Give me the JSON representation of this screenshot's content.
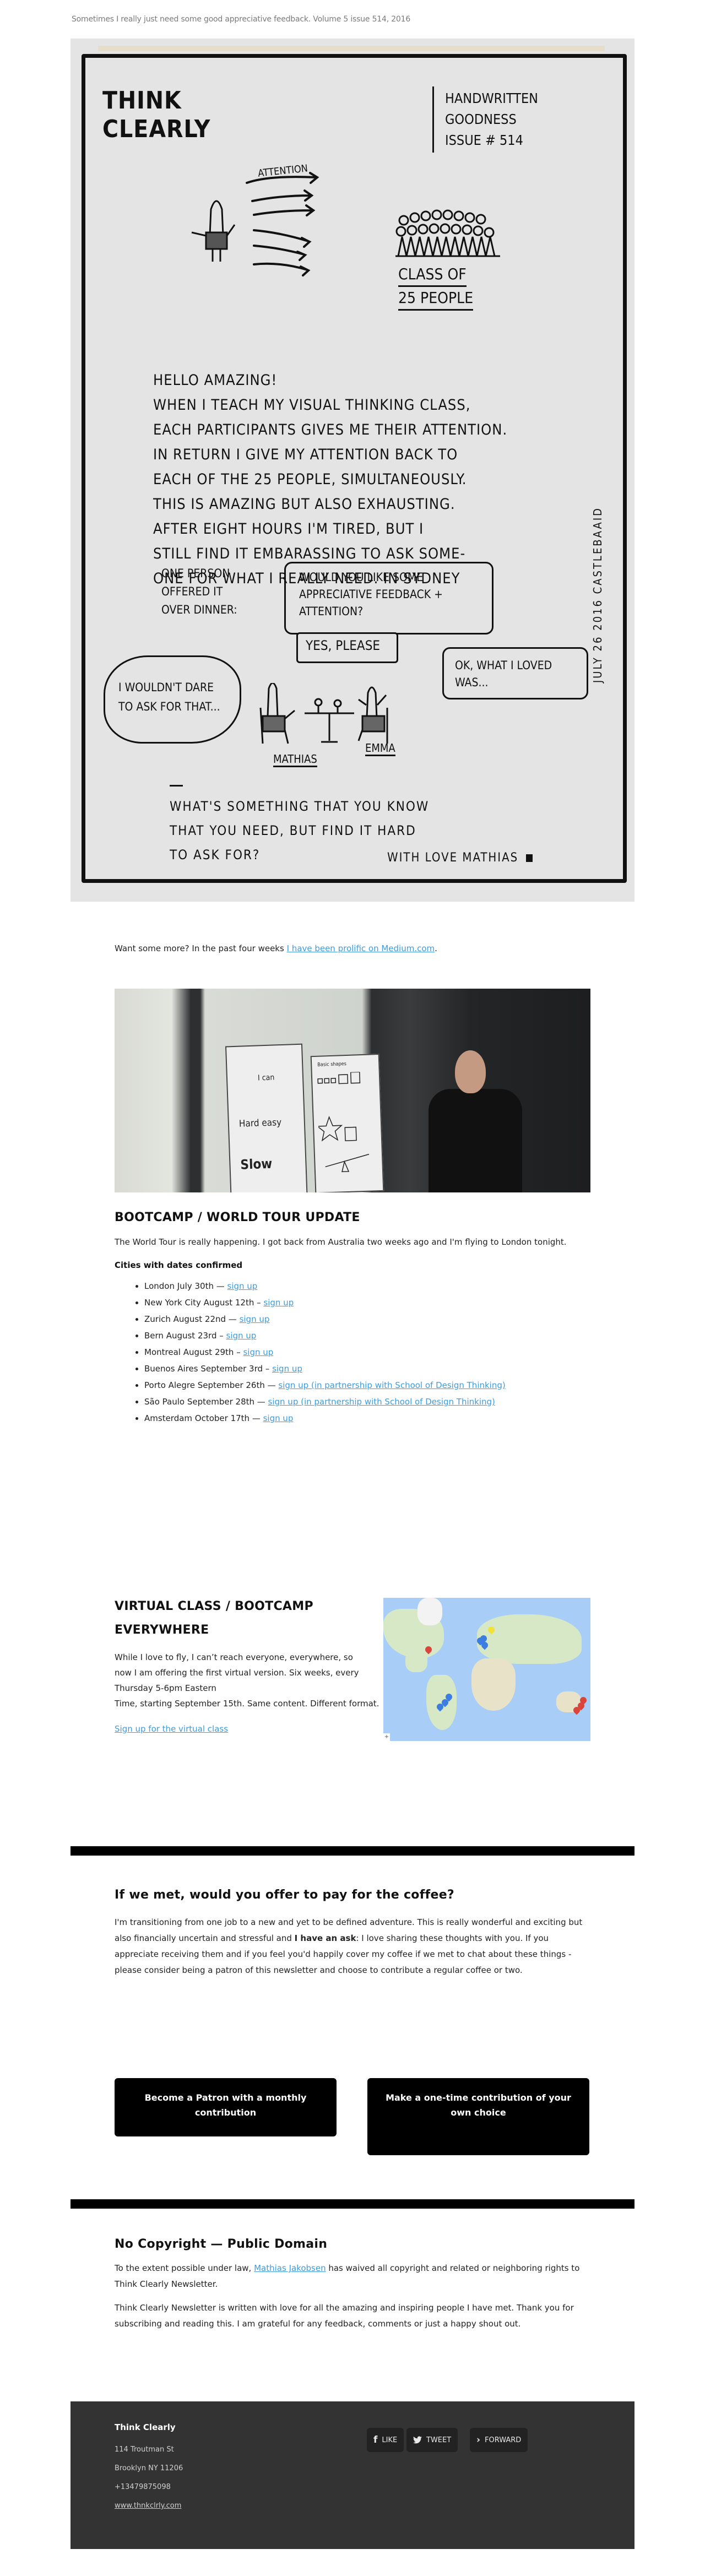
{
  "preheader": "Sometimes I really just need some good appreciative feedback. Volume 5 issue 514, 2016",
  "sketch": {
    "title_lines": [
      "Think",
      "Clearly"
    ],
    "meta_lines": [
      "Handwritten",
      "Goodness",
      "Issue # 514"
    ],
    "attention_label": "Attention",
    "class_lines": [
      "Class of",
      "25 People"
    ],
    "body_lines": [
      "Hello amazing!",
      "When I teach my visual thinking class,",
      "each participants gives me their attention.",
      "In return I give my attention back to",
      "each of the 25 people, simultaneously.",
      "This is amazing but also exhausting.",
      "After eight hours I'm tired, but I",
      "still find it embarassing to ask some-",
      "one for what I really need. In Sydney"
    ],
    "offer_lines": [
      "One person",
      "offered it",
      "over dinner:"
    ],
    "speech_offer": "Would you like some appreciative feedback + attention?",
    "speech_yes": "Yes, please",
    "speech_loved": "Ok, what I loved was...",
    "thought": "I wouldn't dare to ask for that...",
    "name_left": "Mathias",
    "name_right": "Emma",
    "question_lines": [
      "What's something that you know",
      "that you need, but find it hard",
      "to ask for?"
    ],
    "signature": "With love Mathias",
    "vertical": "July 26 2016 Castlebaaid"
  },
  "more": {
    "prefix": "Want some more? In the past four weeks ",
    "link": "I have been prolific on Medium.com",
    "suffix": "."
  },
  "photo": {
    "poster1_lines": [
      "I can",
      "Hard easy",
      "Slow"
    ],
    "poster2_lines": [
      "Basic shapes"
    ]
  },
  "bootcamp": {
    "title": "BOOTCAMP / WORLD TOUR UPDATE",
    "intro": "The World Tour is really happening. I got back from Australia two weeks ago and I'm flying to London tonight.",
    "subtitle": "Cities with dates confirmed",
    "cities": [
      {
        "text": "London July 30th — ",
        "link": "sign up"
      },
      {
        "text": "New York City August 12th – ",
        "link": "sign up"
      },
      {
        "text": "Zurich August 22nd — ",
        "link": "sign up"
      },
      {
        "text": "Bern August 23rd – ",
        "link": "sign up"
      },
      {
        "text": "Montreal August 29th – ",
        "link": "sign up"
      },
      {
        "text": "Buenos Aires September 3rd – ",
        "link": "sign up"
      },
      {
        "text": "Porto Alegre September 26th — ",
        "link": "sign up (in partnership with School of Design Thinking)"
      },
      {
        "text": "São Paulo September 28th — ",
        "link": "sign up (in partnership with School of Design Thinking)"
      },
      {
        "text": "Amsterdam October 17th — ",
        "link": "sign up"
      }
    ]
  },
  "virtual": {
    "title": "VIRTUAL CLASS / BOOTCAMP EVERYWHERE",
    "body_wrapped": "While I love to fly, I can’t reach everyone, everywhere, so now I am offering the first virtual version. Six weeks, every Thursday 5-6pm Eastern",
    "body_rest": "Time, starting September 15th. Same content. Different format.",
    "cta": "Sign up for the virtual class",
    "map": {
      "zoom_control": "+",
      "pins": [
        {
          "place": "Eastern North America",
          "color": "#d9453b"
        },
        {
          "place": "Scandinavia",
          "color": "#f1e23a"
        },
        {
          "place": "United Kingdom",
          "color": "#3b7de0"
        },
        {
          "place": "Northern Europe",
          "color": "#3b7de0"
        },
        {
          "place": "Central Europe",
          "color": "#3b7de0"
        },
        {
          "place": "Southern Brazil",
          "color": "#3b7de0"
        },
        {
          "place": "Southern Brazil 2",
          "color": "#3b7de0"
        },
        {
          "place": "Argentina",
          "color": "#3b7de0"
        },
        {
          "place": "Eastern Australia",
          "color": "#d9453b"
        },
        {
          "place": "Eastern Australia 2",
          "color": "#d9453b"
        },
        {
          "place": "Southeast Australia",
          "color": "#d9453b"
        }
      ]
    }
  },
  "coffee": {
    "title": "If we met, would you offer to pay for the coffee?",
    "body_before": "I'm transitioning from one job to a new and yet to be defined adventure. This is really wonderful and exciting but also financially uncertain and stressful and ",
    "body_bold": "I have an ask",
    "body_after": ": I love sharing these thoughts with you. If you appreciate receiving them and if you feel you'd happily cover my coffee if we met to chat about these things - please consider being a patron of this newsletter and choose to contribute a regular coffee or two.",
    "patron_button": "Become a Patron with a monthly contribution",
    "onetime_button": "Make a one-time contribution of your own choice"
  },
  "copyright": {
    "title": "No Copyright — Public Domain",
    "p1_before": "To the extent possible under law, ",
    "p1_link": "Mathias Jakobsen",
    "p1_after": " has waived all copyright and related or neighboring rights to Think Clearly Newsletter.",
    "p2": "Think Clearly Newsletter is written with love for all the amazing and inspiring people I have met. Thank you for subscribing and reading this. I am grateful for any feedback, comments or just a happy shout out."
  },
  "footer": {
    "org": "Think Clearly",
    "address1": "114 Troutman St",
    "address2": "Brooklyn NY 11206",
    "phone": "+13479875098",
    "website": "www.thnkclrly.com",
    "social": [
      {
        "icon": "facebook-icon",
        "glyph": "f",
        "label": "LIKE"
      },
      {
        "icon": "twitter-icon",
        "glyph": "🐦",
        "label": "TWEET"
      },
      {
        "icon": "forward-icon",
        "glyph": "›",
        "label": "FORWARD"
      }
    ]
  },
  "colors": {
    "link": "#3d9ce0",
    "footer_bg": "#333333",
    "button_bg": "#000000"
  }
}
